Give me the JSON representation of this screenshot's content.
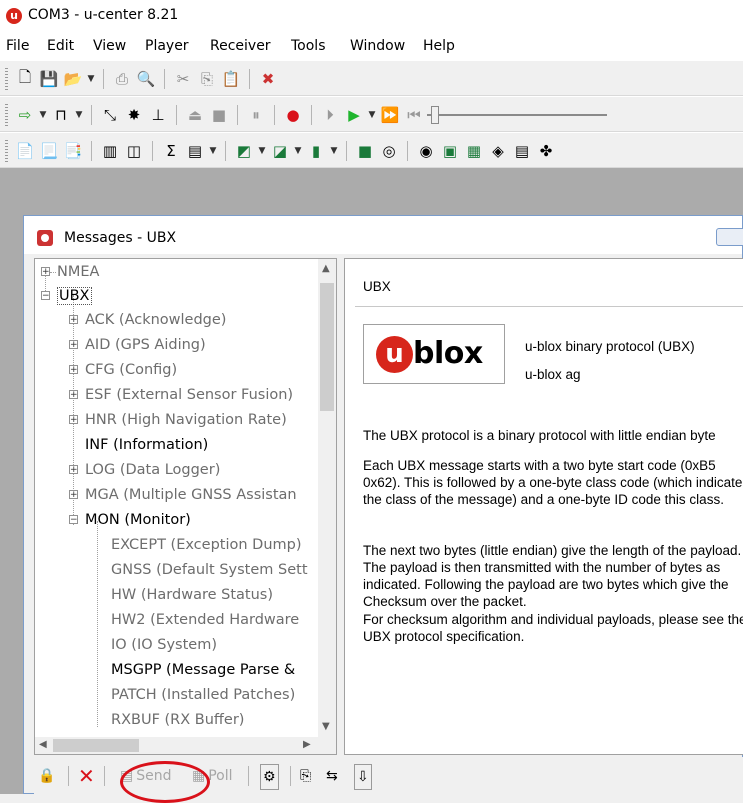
{
  "window": {
    "title": "COM3 - u-center 8.21",
    "app_icon": "u-center-icon"
  },
  "menu": [
    "File",
    "Edit",
    "View",
    "Player",
    "Receiver",
    "Tools",
    "Window",
    "Help"
  ],
  "child_window": {
    "title": "Messages - UBX"
  },
  "tree": {
    "nmea": "NMEA",
    "ubx": "UBX",
    "items": [
      "ACK (Acknowledge)",
      "AID (GPS Aiding)",
      "CFG (Config)",
      "ESF (External Sensor Fusion)",
      "HNR (High Navigation Rate)",
      "INF (Information)",
      "LOG (Data Logger)",
      "MGA (Multiple GNSS Assistan",
      "MON (Monitor)"
    ],
    "mon_children": [
      "EXCEPT (Exception Dump)",
      "GNSS (Default System Sett",
      "HW (Hardware Status)",
      "HW2 (Extended Hardware",
      "IO (IO System)",
      "MSGPP (Message Parse &",
      "PATCH (Installed Patches)",
      "RXBUF (RX Buffer)"
    ]
  },
  "info": {
    "header": "UBX",
    "logo_text": "blox",
    "logo_u": "u",
    "description": "u-blox binary protocol (UBX)",
    "vendor": "u-blox ag",
    "paragraphs": [
      "The UBX protocol is a binary protocol with little endian byte",
      "Each UBX message starts with a two byte start code (0xB5 0x62). This is followed by a one-byte class code (which indicates the class of the message) and a one-byte ID code this class.",
      "The next two bytes (little endian) give the length of the payload. The payload is then transmitted with the number of bytes as indicated. Following the payload are two bytes which give the Checksum over the packet.",
      "For checksum algorithm and individual payloads, please see the UBX protocol specification."
    ]
  },
  "bottom_bar": {
    "send_label": "Send",
    "poll_label": "Poll"
  },
  "colors": {
    "accent_red": "#d7261b",
    "highlight_circle": "#d9111a"
  }
}
